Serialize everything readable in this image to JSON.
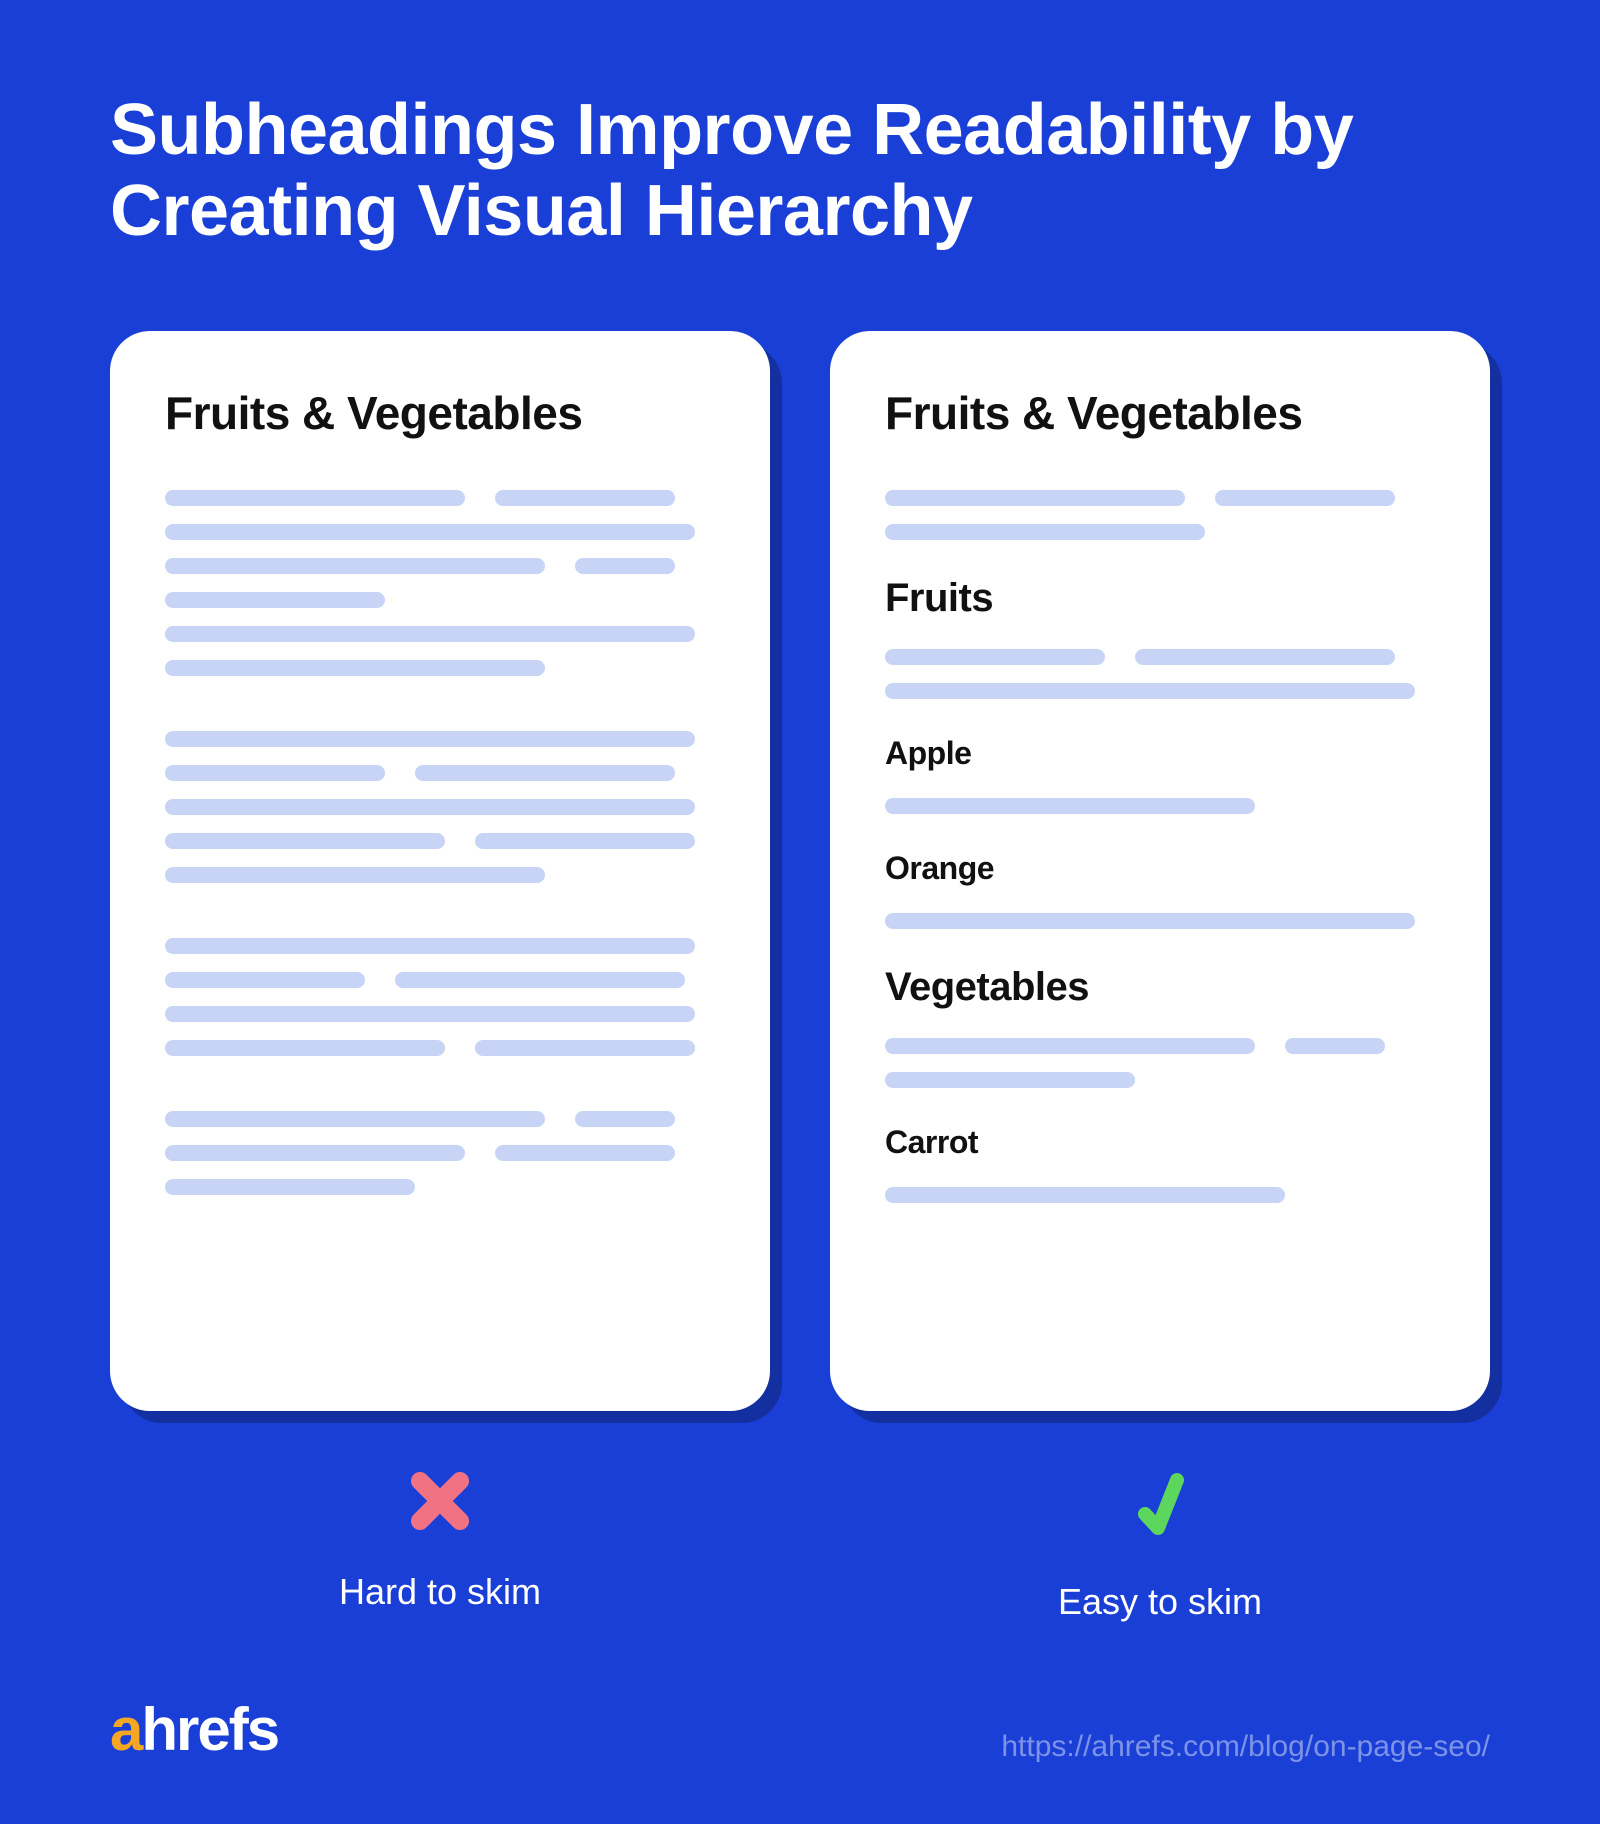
{
  "title": "Subheadings Improve Readability by Creating Visual Hierarchy",
  "left": {
    "card_title": "Fruits & Vegetables",
    "icon": "cross-icon",
    "label": "Hard to skim"
  },
  "right": {
    "card_title": "Fruits & Vegetables",
    "h2_a": "Fruits",
    "h3_a": "Apple",
    "h3_b": "Orange",
    "h2_b": "Vegetables",
    "h3_c": "Carrot",
    "icon": "check-icon",
    "label": "Easy to skim"
  },
  "logo": {
    "a": "a",
    "rest": "hrefs"
  },
  "footer_url": "https://ahrefs.com/blog/on-page-seo/",
  "colors": {
    "bg": "#1a3fd6",
    "placeholder": "#c7d4f5",
    "cross": "#f17383",
    "check": "#5dd65d",
    "logo_a": "#f5a623"
  }
}
